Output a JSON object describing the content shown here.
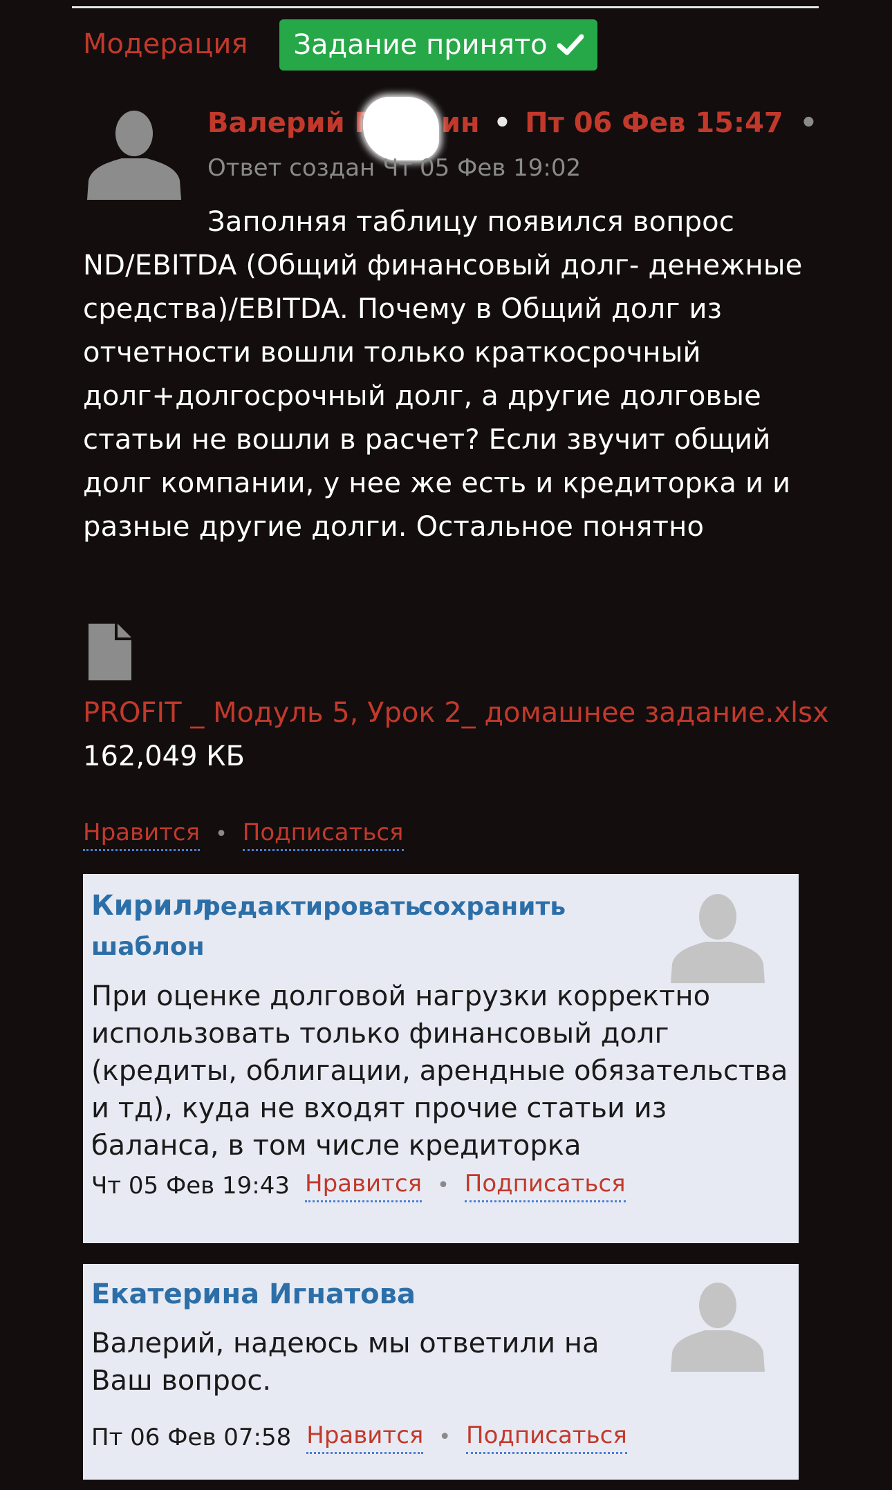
{
  "header": {
    "moderation_label": "Модерация",
    "status_badge": "Задание принято",
    "status_icon": "check-icon"
  },
  "post": {
    "author": "Валерий П",
    "author_suffix": "ин",
    "separator": "•",
    "date": "Пт 06 Фев 15:47",
    "trailing_dot": "•",
    "created": "Ответ создан Чт 05 Фев 19:02",
    "text": "Заполняя таблицу появился вопрос ND/EBITDA (Общий финансовый долг- денежные средства)/EBITDA. Почему в Общий долг из отчетности вошли только краткосрочный долг+долгосрочный долг, а другие долговые статьи не вошли в расчет? Если звучит общий долг компании, у нее же есть и кредиторка и и разные другие долги. Остальное понятно",
    "attachment": {
      "file_name": "PROFIT _ Модуль 5, Урок 2_ домашнее задание.xlsx",
      "file_size": "162,049 КБ"
    },
    "like_label": "Нравится",
    "dot": "•",
    "subscribe_label": "Подписаться"
  },
  "comments": [
    {
      "author": "Кирилл",
      "edit_label": "редактировать",
      "save_label": "сохранить",
      "template_label": "шаблон",
      "text": "При оценке долговой нагрузки корректно использовать только финансовый долг (кредиты, облигации, арендные обязательства и тд), куда не входят прочие статьи из баланса, в том числе кредиторка",
      "time": "Чт 05 Фев 19:43",
      "like_label": "Нравится",
      "dot": "•",
      "subscribe_label": "Подписаться"
    },
    {
      "author": "Екатерина Игнатова",
      "text": "Валерий, надеюсь мы ответили на Ваш вопрос.",
      "time": "Пт 06 Фев 07:58",
      "like_label": "Нравится",
      "dot": "•",
      "subscribe_label": "Подписаться"
    }
  ],
  "colors": {
    "background": "#130d0e",
    "accent_red": "#c2392b",
    "success_green": "#27a848",
    "comment_bg": "#e8eaf3",
    "comment_name_blue": "#2c6fa8"
  }
}
